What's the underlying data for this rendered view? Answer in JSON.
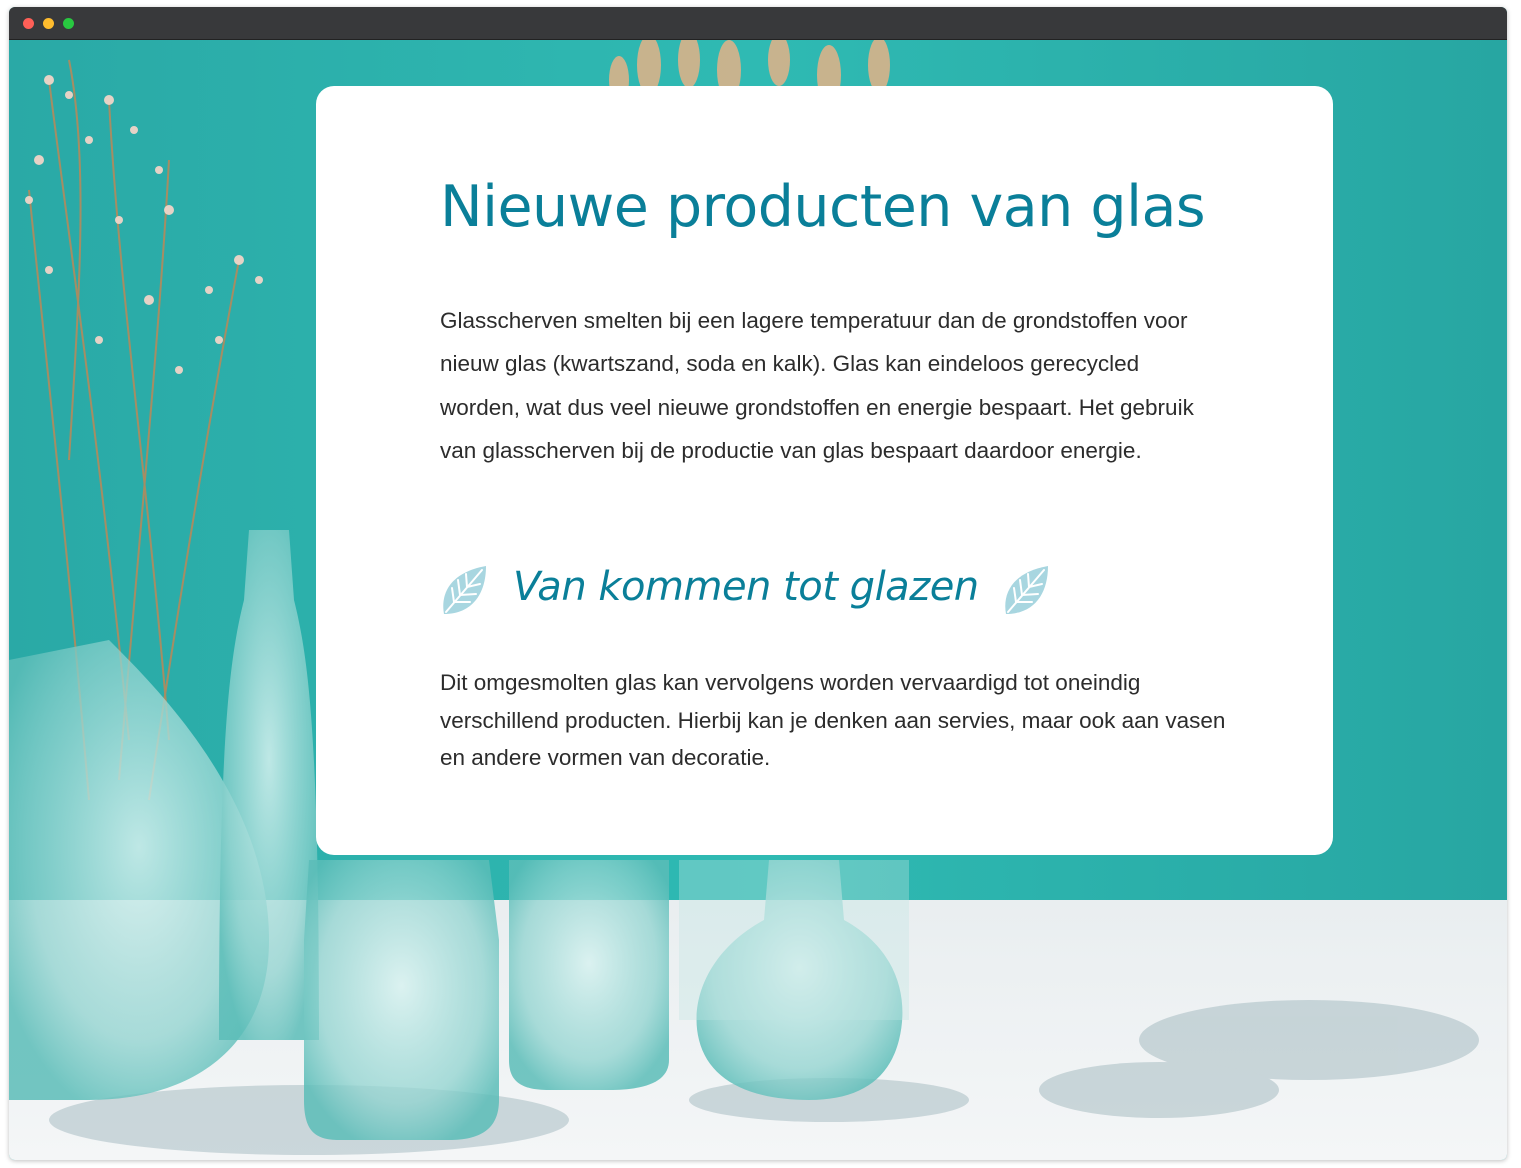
{
  "window": {
    "controls": [
      "close",
      "minimize",
      "zoom"
    ]
  },
  "colors": {
    "accent": "#0a7f99",
    "teal_wall": "#2cb3ad",
    "leaf": "#a8d6e0",
    "body_text": "#2c2c2c"
  },
  "card": {
    "title": "Nieuwe producten van glas",
    "paragraph_1": "Glasscherven smelten bij een lagere temperatuur dan de grondstoffen voor nieuw glas (kwartszand, soda en kalk). Glas kan eindeloos gerecycled worden, wat dus veel nieuwe grondstoffen en energie bespaart. Het gebruik van glasscherven bij de productie van glas bespaart daardoor energie.",
    "subheading": "Van kommen tot glazen",
    "subheading_icons": [
      "leaf-icon",
      "leaf-icon"
    ],
    "paragraph_2": "Dit omgesmolten glas kan vervolgens worden vervaardigd tot oneindig verschillend producten. Hierbij kan je denken aan servies, maar ook aan vasen en andere vormen van decoratie."
  }
}
